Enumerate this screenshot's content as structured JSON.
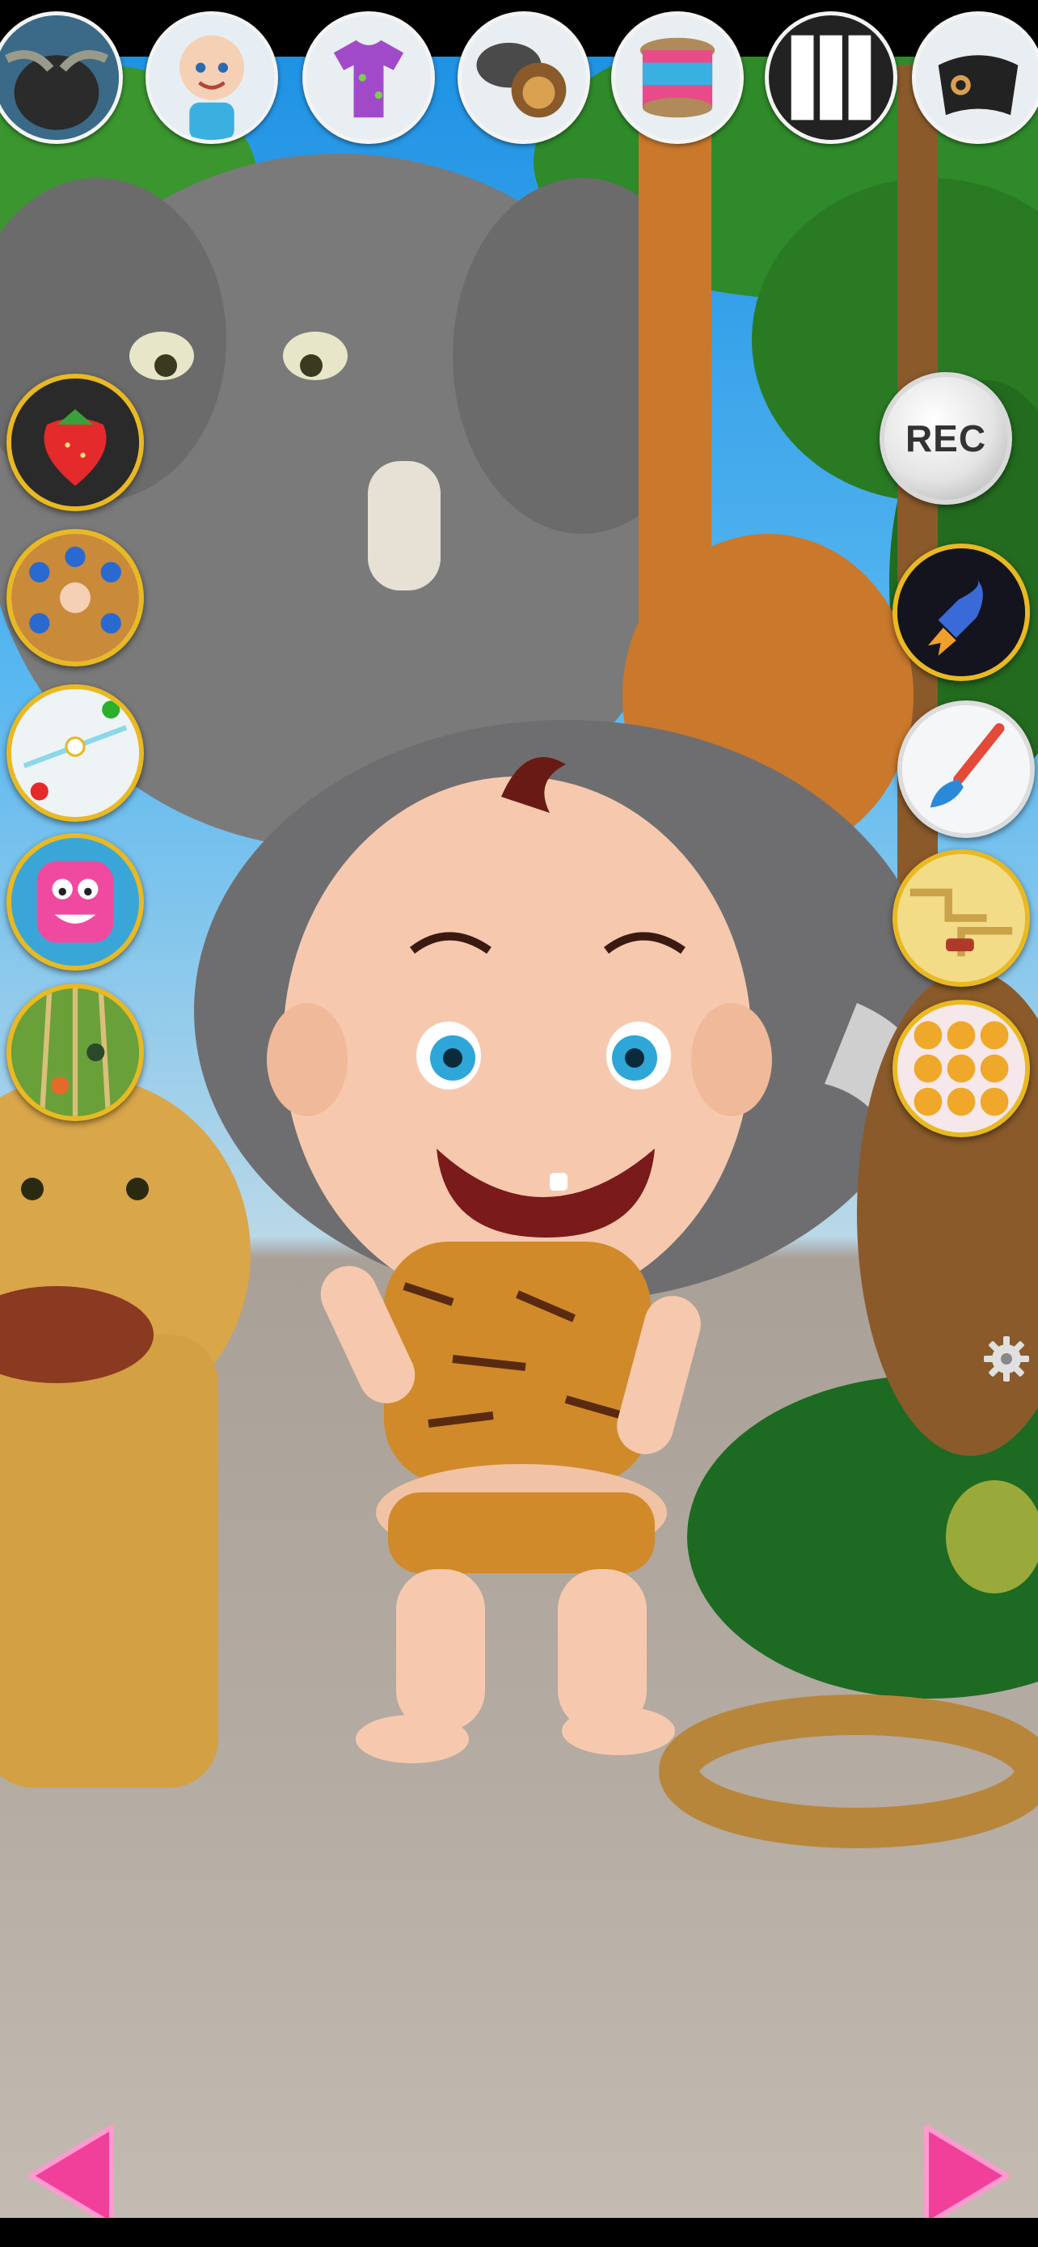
{
  "top_bar": {
    "items": [
      {
        "name": "buffalo-scene",
        "icon": "buffalo-icon"
      },
      {
        "name": "baby-character",
        "icon": "baby-icon"
      },
      {
        "name": "clothes",
        "icon": "shirt-icon"
      },
      {
        "name": "animals-scene",
        "icon": "lion-icon"
      },
      {
        "name": "drum",
        "icon": "drum-icon"
      },
      {
        "name": "piano",
        "icon": "piano-icon"
      },
      {
        "name": "gamepad",
        "icon": "gamepad-icon"
      }
    ]
  },
  "left_games": [
    {
      "name": "fruit-game",
      "icon": "strawberry-icon"
    },
    {
      "name": "twister-game",
      "icon": "twister-icon"
    },
    {
      "name": "air-hockey-game",
      "icon": "air-hockey-icon"
    },
    {
      "name": "jelly-face-game",
      "icon": "pink-face-icon"
    },
    {
      "name": "bowling-game",
      "icon": "lanes-icon"
    }
  ],
  "right_controls": {
    "rec_label": "REC",
    "games": [
      {
        "name": "rocket-game",
        "icon": "rocket-icon"
      },
      {
        "name": "paint",
        "icon": "paintbrush-icon"
      },
      {
        "name": "maze-game",
        "icon": "maze-icon"
      },
      {
        "name": "emoji-match-game",
        "icon": "emoji-grid-icon"
      }
    ]
  },
  "colors": {
    "accent_gold": "#e9b922",
    "nav_arrow": "#f0409a",
    "sky": "#1a8fe3",
    "ground": "#b5aca3"
  }
}
